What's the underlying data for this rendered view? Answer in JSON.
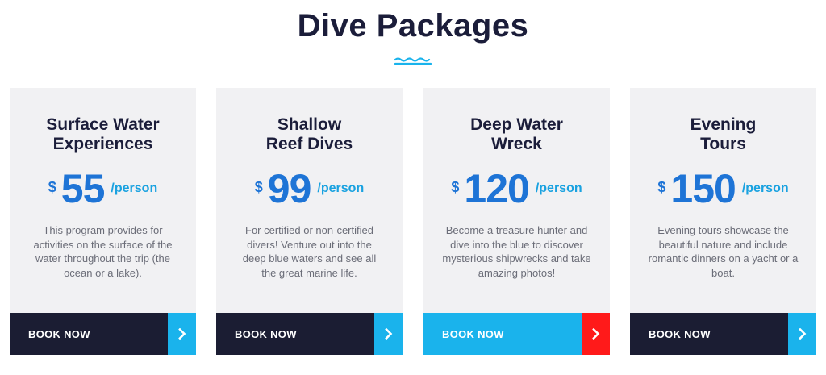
{
  "page": {
    "title": "Dive Packages"
  },
  "colors": {
    "title": "#1b1d3a",
    "price": "#1e74d6",
    "per_person": "#1aa2e0",
    "card_bg": "#f1f1f3",
    "button_dark": "#1b1d33",
    "button_accent": "#1ab3ec",
    "button_hover_arrow": "#ff1a1a"
  },
  "packages": [
    {
      "title_line1": "Surface Water",
      "title_line2": "Experiences",
      "currency": "$",
      "price": "55",
      "per": "/person",
      "description": "This program provides for activities on the surface of the water throughout the trip (the ocean or a lake).",
      "button_label": "BOOK NOW",
      "arrow_icon": "chevron-right-icon"
    },
    {
      "title_line1": "Shallow",
      "title_line2": "Reef Dives",
      "currency": "$",
      "price": "99",
      "per": "/person",
      "description": "For certified or non-certified divers! Venture out into the deep blue waters and see all the great marine life.",
      "button_label": "BOOK NOW",
      "arrow_icon": "chevron-right-icon"
    },
    {
      "title_line1": "Deep Water",
      "title_line2": "Wreck",
      "currency": "$",
      "price": "120",
      "per": "/person",
      "description": "Become a treasure hunter and dive into the blue to discover mysterious shipwrecks and take amazing photos!",
      "button_label": "BOOK NOW",
      "arrow_icon": "chevron-right-icon"
    },
    {
      "title_line1": "Evening",
      "title_line2": "Tours",
      "currency": "$",
      "price": "150",
      "per": "/person",
      "description": "Evening tours showcase the beautiful nature and include romantic dinners on a yacht or a boat.",
      "button_label": "BOOK NOW",
      "arrow_icon": "chevron-right-icon"
    }
  ]
}
